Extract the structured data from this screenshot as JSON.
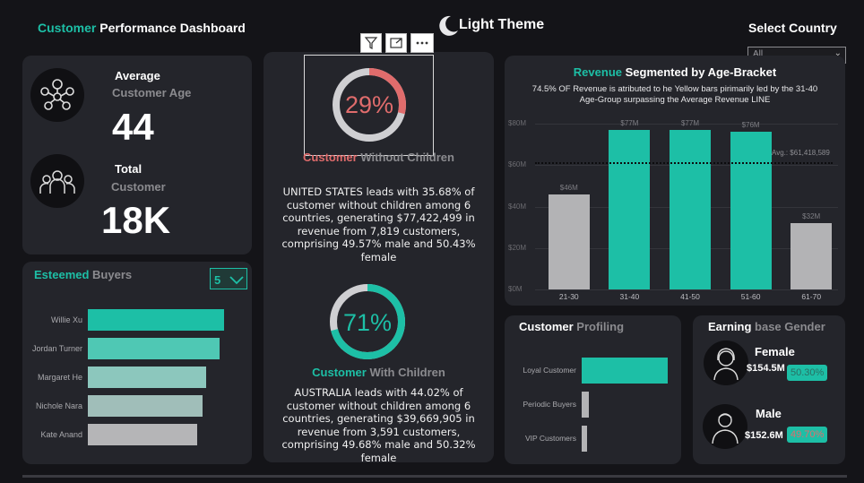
{
  "header": {
    "title_accent": "Customer",
    "title_rest": " Performance Dashboard",
    "theme_label": "Light Theme",
    "country_label": "Select Country",
    "country_value": "All"
  },
  "stats": {
    "age_label": "Average",
    "age_sub": "Customer Age",
    "age_value": "44",
    "total_label": "Total",
    "total_sub": "Customer",
    "total_value": "18K"
  },
  "buyers": {
    "title_accent": "Esteemed",
    "title_rest": " Buyers",
    "top_n": "5",
    "items": [
      {
        "name": "Willie Xu",
        "value": 1.0,
        "color": "#1dbfa6"
      },
      {
        "name": "Jordan Turner",
        "value": 0.97,
        "color": "#4fc8b4"
      },
      {
        "name": "Margaret He",
        "value": 0.87,
        "color": "#8cc7bd"
      },
      {
        "name": "Nichole Nara",
        "value": 0.84,
        "color": "#a0beb9"
      },
      {
        "name": "Kate Anand",
        "value": 0.8,
        "color": "#b5b5b7"
      }
    ]
  },
  "no_children": {
    "percent": "29%",
    "percent_value": 29,
    "title_accent": "Customer",
    "title_rest": " Without Children",
    "description": "UNITED STATES leads with 35.68% of customer without children among 6 countries, generating $77,422,499 in revenue from 7,819 customers, comprising 49.57% male and 50.43% female"
  },
  "with_children": {
    "percent": "71%",
    "percent_value": 71,
    "title_accent": "Customer",
    "title_rest": " With Children",
    "description": "AUSTRALIA leads with 44.02% of customer without children among 6 countries, generating $39,669,905 in revenue from 3,591 customers, comprising 49.68% male and 50.32% female"
  },
  "visual_toolbar": {
    "filter_icon": "filter-icon",
    "focus_icon": "focus-mode-icon",
    "more_icon": "more-options-icon"
  },
  "chart_data": {
    "type": "bar",
    "title_accent": "Revenue",
    "title_rest": " Segmented by Age-Bracket",
    "subtitle": "74.5% OF Revenue is atributed to he Yellow bars pirimarily led by the 31-40 Age-Group surpassing the Average Revenue LINE",
    "categories": [
      "21-30",
      "31-40",
      "41-50",
      "51-60",
      "61-70"
    ],
    "values": [
      46,
      77,
      77,
      76,
      32
    ],
    "value_labels": [
      "$46M",
      "$77M",
      "$77M",
      "$76M",
      "$32M"
    ],
    "colors": [
      "#b3b3b5",
      "#1dbfa6",
      "#1dbfa6",
      "#1dbfa6",
      "#b3b3b5"
    ],
    "y_ticks": [
      "$0M",
      "$20M",
      "$40M",
      "$60M",
      "$80M"
    ],
    "ylim": [
      0,
      80
    ],
    "average": 61.418589,
    "average_label": "Avg.: $61,418,589",
    "grid": true
  },
  "profiling": {
    "title_accent": "Customer",
    "title_rest": "  Profiling",
    "items": [
      {
        "label": "Loyal Customer",
        "value": 1.0,
        "color": "#1dbfa6"
      },
      {
        "label": "Periodic Buyers",
        "value": 0.08,
        "color": "#b3b3b5"
      },
      {
        "label": "VIP Customers",
        "value": 0.06,
        "color": "#b3b3b5"
      }
    ]
  },
  "gender": {
    "title_accent": "Earning",
    "title_rest": " base Gender",
    "female_label": "Female",
    "female_revenue": "$154.5M",
    "female_pct": "50.30%",
    "male_label": "Male",
    "male_revenue": "$152.6M",
    "male_pct": "49.70%"
  }
}
